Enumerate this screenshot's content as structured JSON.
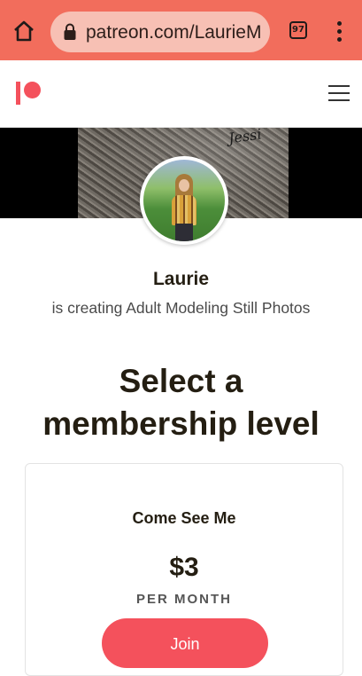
{
  "browser": {
    "url": "patreon.com/LaurieM",
    "tab_count": "97"
  },
  "cover": {
    "script_text": "Jessi"
  },
  "creator": {
    "name": "Laurie",
    "tagline": "is creating Adult Modeling Still Photos"
  },
  "page": {
    "heading_line1": "Select a",
    "heading_line2": "membership level"
  },
  "tier": {
    "name": "Come See Me",
    "price": "$3",
    "period": "PER MONTH",
    "join_label": "Join"
  },
  "colors": {
    "chrome": "#f26d5c",
    "brand": "#f4515c"
  }
}
